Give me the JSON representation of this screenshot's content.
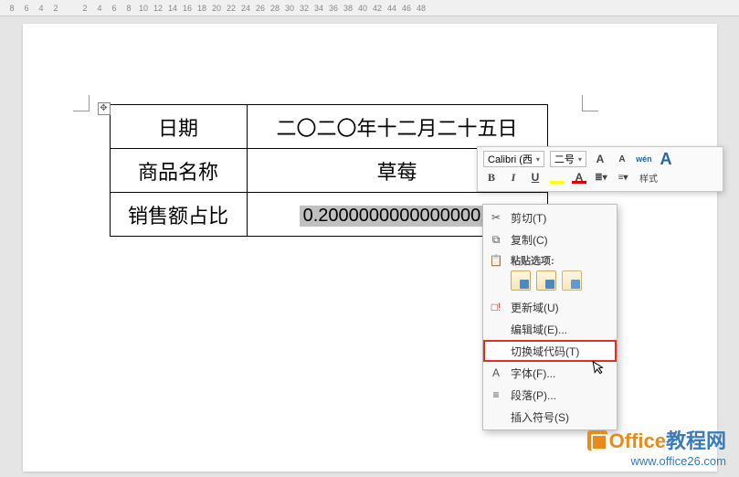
{
  "ruler": {
    "marks": [
      "8",
      "6",
      "4",
      "2",
      "",
      "2",
      "4",
      "6",
      "8",
      "10",
      "12",
      "14",
      "16",
      "18",
      "20",
      "22",
      "24",
      "26",
      "28",
      "30",
      "32",
      "34",
      "36",
      "38",
      "40",
      "42",
      "44",
      "46",
      "48"
    ]
  },
  "table": {
    "rows": [
      {
        "label": "日期",
        "value": "二〇二〇年十二月二十五日"
      },
      {
        "label": "商品名称",
        "value": "草莓"
      },
      {
        "label": "销售额占比",
        "value": "0.20000000000000001"
      }
    ]
  },
  "mini_toolbar": {
    "font_name": "Calibri (西",
    "font_size": "二号",
    "increase": "A",
    "decrease": "A",
    "phonetic": "wén",
    "format_painter": "✎",
    "bold": "B",
    "italic": "I",
    "underline": "U",
    "highlight": "ab",
    "fontcolor": "A",
    "styles_label": "样式"
  },
  "context_menu": {
    "cut": "剪切(T)",
    "copy": "复制(C)",
    "paste_label": "粘贴选项:",
    "update_field": "更新域(U)",
    "edit_field": "编辑域(E)...",
    "toggle_field": "切换域代码(T)",
    "font": "字体(F)...",
    "paragraph": "段落(P)...",
    "insert_symbol": "插入符号(S)"
  },
  "watermark": {
    "line1a": "Office",
    "line1b": "教程网",
    "line2": "www.office26.com"
  }
}
